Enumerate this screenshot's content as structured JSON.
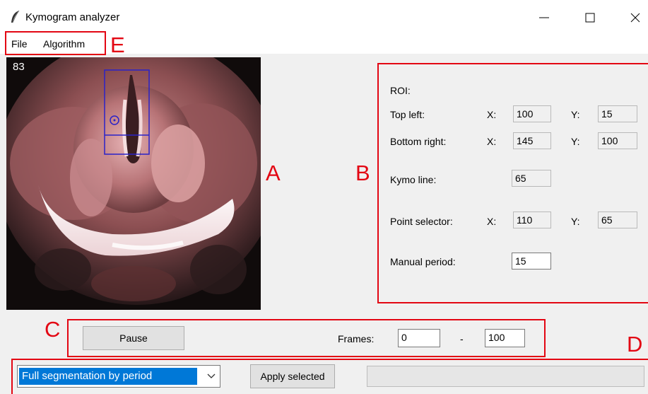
{
  "window": {
    "title": "Kymogram analyzer"
  },
  "menu": {
    "items": [
      "File",
      "Algorithm"
    ]
  },
  "annotations": {
    "a": "A",
    "b": "B",
    "c": "C",
    "d": "D",
    "e": "E"
  },
  "video": {
    "frame_number": "83"
  },
  "roi_panel": {
    "heading": "ROI:",
    "top_left_label": "Top left:",
    "bottom_right_label": "Bottom right:",
    "x_label": "X:",
    "y_label": "Y:",
    "top_left_x": "100",
    "top_left_y": "15",
    "bottom_right_x": "145",
    "bottom_right_y": "100",
    "kymo_line_label": "Kymo line:",
    "kymo_line": "65",
    "point_selector_label": "Point selector:",
    "point_x": "110",
    "point_y": "65",
    "manual_period_label": "Manual period:",
    "manual_period": "15"
  },
  "controls": {
    "pause_label": "Pause",
    "frames_label": "Frames:",
    "frames_start": "0",
    "frames_dash": "-",
    "frames_end": "100"
  },
  "bottom": {
    "algorithm_selected": "Full segmentation by period",
    "apply_label": "Apply selected",
    "progress": 0
  },
  "colors": {
    "annotation": "#e30613",
    "roi_box": "#2a22c8",
    "selection": "#0078d7"
  }
}
